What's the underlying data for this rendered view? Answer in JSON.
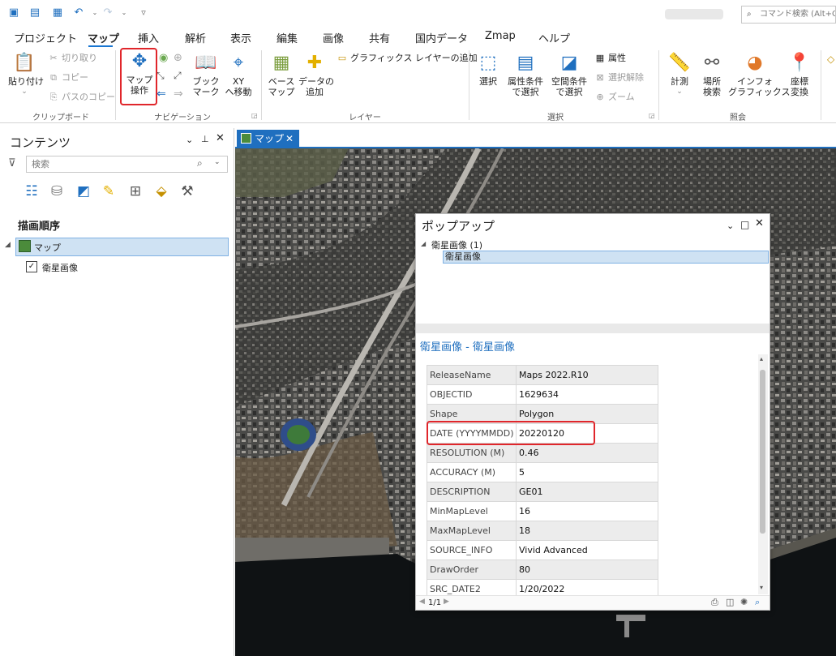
{
  "qat": {
    "command_search_placeholder": "コマンド検索 (Alt+Q)",
    "icons": [
      "new-project-icon",
      "open-project-icon",
      "save-project-icon",
      "undo-icon",
      "redo-icon",
      "customize-icon"
    ]
  },
  "tabs": [
    "プロジェクト",
    "マップ",
    "挿入",
    "解析",
    "表示",
    "編集",
    "画像",
    "共有",
    "国内データ",
    "Zmap",
    "ヘルプ"
  ],
  "active_tab": "マップ",
  "ribbon": {
    "clipboard": {
      "group": "クリップボード",
      "paste": "貼り付け",
      "cut": "切り取り",
      "copy": "コピー",
      "copy_path": "パスのコピー"
    },
    "navigation": {
      "group": "ナビゲーション",
      "map_nav_line1": "マップ",
      "map_nav_line2": "操作",
      "bookmark_line1": "ブック",
      "bookmark_line2": "マーク",
      "xy_line1": "XY",
      "xy_line2": "へ移動"
    },
    "layer": {
      "group": "レイヤー",
      "basemap_line1": "ベース",
      "basemap_line2": "マップ",
      "add_data_line1": "データの",
      "add_data_line2": "追加",
      "add_graphics": "グラフィックス レイヤーの追加"
    },
    "selection": {
      "group": "選択",
      "select": "選択",
      "by_attr_line1": "属性条件",
      "by_attr_line2": "で選択",
      "by_loc_line1": "空間条件",
      "by_loc_line2": "で選択",
      "attributes": "属性",
      "clear": "選択解除",
      "zoom": "ズーム"
    },
    "inquiry": {
      "group": "照会",
      "measure": "計測",
      "locate_line1": "場所",
      "locate_line2": "検索",
      "infographics_line1": "インフォ",
      "infographics_line2": "グラフィックス",
      "coord_line1": "座標",
      "coord_line2": "変換"
    }
  },
  "contents": {
    "title": "コンテンツ",
    "search_placeholder": "検索",
    "draw_order": "描画順序",
    "map_item": "マップ",
    "layer_item": "衛星画像",
    "icons": [
      "list-by-drawing-order-icon",
      "list-by-data-source-icon",
      "list-by-selection-icon",
      "list-by-editing-icon",
      "list-by-snapping-icon",
      "list-by-labeling-icon",
      "list-by-perspective-icon"
    ]
  },
  "map_tab": "マップ",
  "popup": {
    "title": "ポップアップ",
    "tree_parent": "衛星画像 (1)",
    "tree_child": "衛星画像",
    "feature_title": "衛星画像 - 衛星画像",
    "fields": [
      {
        "k": "ReleaseName",
        "v": "Maps 2022.R10"
      },
      {
        "k": "OBJECTID",
        "v": "1629634"
      },
      {
        "k": "Shape",
        "v": "Polygon"
      },
      {
        "k": "DATE (YYYYMMDD)",
        "v": "20220120"
      },
      {
        "k": "RESOLUTION (M)",
        "v": "0.46"
      },
      {
        "k": "ACCURACY (M)",
        "v": "5"
      },
      {
        "k": "DESCRIPTION",
        "v": "GE01"
      },
      {
        "k": "MinMapLevel",
        "v": "16"
      },
      {
        "k": "MaxMapLevel",
        "v": "18"
      },
      {
        "k": "SOURCE_INFO",
        "v": "Vivid Advanced"
      },
      {
        "k": "DrawOrder",
        "v": "80"
      },
      {
        "k": "SRC_DATE2",
        "v": "1/20/2022"
      }
    ],
    "pager": "1/1"
  },
  "colors": {
    "accent": "#1f6fbf",
    "highlight": "#e0262b",
    "selection": "#cfe2f3"
  }
}
